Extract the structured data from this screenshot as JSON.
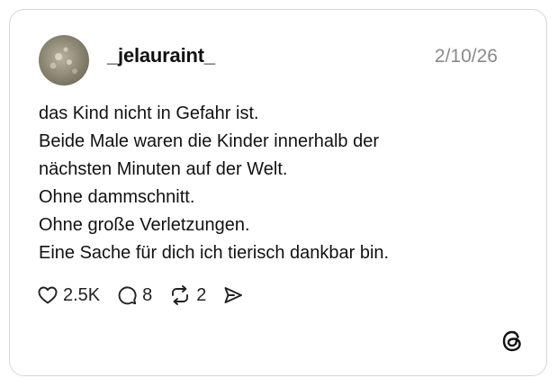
{
  "post": {
    "username": "_jelauraint_",
    "date": "2/10/26",
    "lines": [
      "das Kind nicht in Gefahr ist.",
      "Beide Male waren die Kinder innerhalb der",
      "nächsten Minuten auf der Welt.",
      "Ohne dammschnitt.",
      "Ohne große Verletzungen.",
      "Eine Sache für dich ich tierisch dankbar bin."
    ]
  },
  "actions": {
    "likes": "2.5K",
    "comments": "8",
    "reposts": "2"
  },
  "icons": {
    "like": "heart-icon",
    "comment": "comment-bubble-icon",
    "repost": "repost-icon",
    "share": "send-icon",
    "brand": "threads-logo-icon"
  },
  "colors": {
    "border": "#d6d6d6",
    "text": "#111111",
    "muted": "#8a8a8a"
  }
}
